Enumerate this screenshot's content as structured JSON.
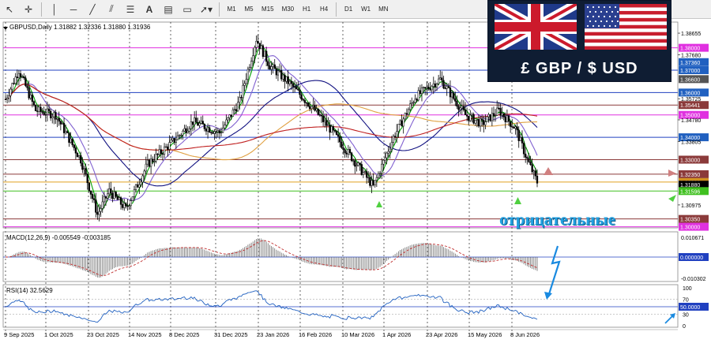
{
  "toolbar": {
    "timeframes": [
      "M1",
      "M5",
      "M15",
      "M30",
      "H1",
      "H4",
      "D1",
      "W1",
      "MN"
    ],
    "tools": [
      "cursor-icon",
      "crosshair-icon",
      "vertical-line-icon",
      "horizontal-line-icon",
      "trendline-icon",
      "equidistant-channel-icon",
      "fibonacci-icon",
      "text-icon",
      "text-label-icon",
      "rectangle-icon",
      "arrows-icon"
    ]
  },
  "chart": {
    "header": "GBPUSD,Daily  1.31882 1.32336 1.31880 1.31936",
    "price_labels": [
      "1.38655",
      "1.38000",
      "1.37680",
      "1.37360",
      "1.37000",
      "1.36600",
      "1.36000",
      "1.35725",
      "1.35441",
      "1.35000",
      "1.34780",
      "1.34000",
      "1.33805",
      "1.33000",
      "1.32350",
      "1.32000",
      "1.31880",
      "1.31596",
      "1.30975",
      "1.30350",
      "1.30000"
    ],
    "dates": [
      "9 Sep 2025",
      "1 Oct 2025",
      "23 Oct 2025",
      "14 Nov 2025",
      "8 Dec 2025",
      "31 Dec 2025",
      "23 Jan 2026",
      "16 Feb 2026",
      "10 Mar 2026",
      "1 Apr 2026",
      "23 Apr 2026",
      "15 May 2026",
      "8 Jun 2026"
    ]
  },
  "macd": {
    "header": "MACD(12,26,9) -0.005549 -0.003185",
    "labels": [
      "0.010671",
      "0.000000",
      "-0.010302"
    ]
  },
  "rsi": {
    "header": "RSI(14) 32.5629",
    "labels": [
      "100",
      "70",
      "50.0000",
      "30",
      "0"
    ]
  },
  "banner": {
    "pair_text": "£ GBP   /   $ USD"
  },
  "annotation": {
    "text": "отрицательные"
  },
  "colors": {
    "grid": "#dcdcdc",
    "level_magenta": "#e030e0",
    "level_blue": "#2040c0",
    "level_brown": "#8b3a3a",
    "level_orange": "#e0a020",
    "level_green": "#40c020",
    "ma_fast": "#00a000",
    "ma_mid": "#8060d0",
    "ma_slow": "#101080",
    "ma_orange": "#e0a040",
    "ma_red": "#c02020",
    "macd_signal": "#c03030",
    "rsi_line": "#2060c0",
    "arrow_blue": "#1a8ae0"
  }
}
